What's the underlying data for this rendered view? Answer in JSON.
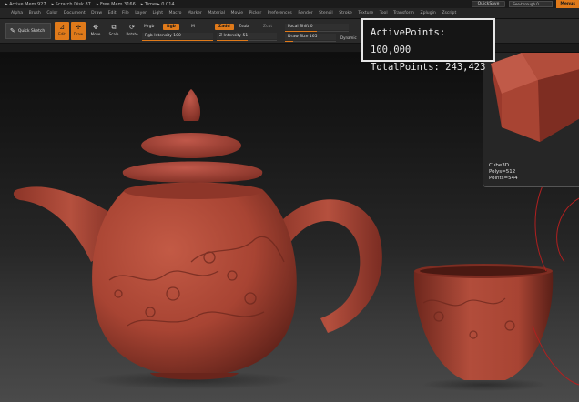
{
  "titlebar": {
    "items": [
      "▸ Active Mem 927",
      "▸ Scratch Disk 87",
      "▸ Free Mem 3166",
      "▸ Timer▸ 0.014"
    ],
    "quicksave_label": "QuickSave",
    "see_through_label": "See-through 0",
    "see_through_value": 0,
    "menus_label": "Menus"
  },
  "menubar": {
    "items": [
      "Alpha",
      "Brush",
      "Color",
      "Document",
      "Draw",
      "Edit",
      "File",
      "Layer",
      "Light",
      "Macro",
      "Marker",
      "Material",
      "Movie",
      "Picker",
      "Preferences",
      "Render",
      "Stencil",
      "Stroke",
      "Texture",
      "Tool",
      "Transform",
      "Zplugin",
      "Zscript"
    ]
  },
  "shelf": {
    "quick_sketch_label": "Quick Sketch",
    "edit_label": "Edit",
    "draw_label": "Draw",
    "move_label": "Move",
    "scale_label": "Scale",
    "rotate_label": "Rotate",
    "mrgb_label": "Mrgb",
    "rgb_label": "Rgb",
    "m_label": "M",
    "rgb_intensity_label": "Rgb Intensity 100",
    "rgb_intensity_value": 100,
    "zadd_label": "Zadd",
    "zsub_label": "Zsub",
    "zcut_label": "Zcut",
    "z_intensity_label": "Z Intensity 51",
    "z_intensity_value": 51,
    "focal_shift_label": "Focal Shift 0",
    "focal_shift_value": 0,
    "draw_size_label": "Draw Size 165",
    "draw_size_value": 165,
    "draw_size_max": 1000,
    "dynamic_label": "Dynamic"
  },
  "overlay": {
    "active_points": "ActivePoints: 100,000",
    "total_points": "TotalPoints: 243,423"
  },
  "thumbnail": {
    "tool_name": "Cube3D",
    "polys": "Polys=512",
    "points": "Points=544"
  },
  "colors": {
    "accent": "#e07a1a",
    "clay": "#a84433",
    "overlay_border": "#e6e6e6"
  }
}
